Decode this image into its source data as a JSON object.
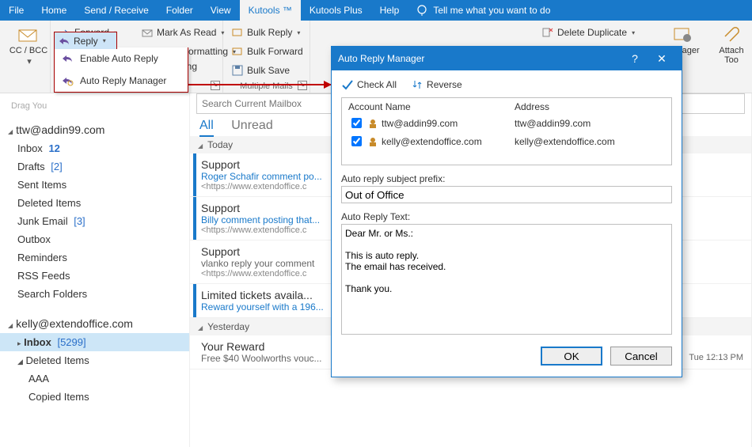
{
  "tabs": {
    "file": "File",
    "home": "Home",
    "sendrecv": "Send / Receive",
    "folder": "Folder",
    "view": "View",
    "kutools": "Kutools ™",
    "kutoolsplus": "Kutools Plus",
    "help": "Help",
    "tellme": "Tell me what you want to do"
  },
  "ribbon": {
    "ccbcc": "CC / BCC",
    "forward": "Forward",
    "markread": "Mark As Read",
    "reply": "Reply",
    "fixedfmt": "Fixed Formatting",
    "dragyour": "Drag You",
    "bulkreply": "Bulk Reply",
    "bulkfwd": "Bulk Forward",
    "bulksave": "Bulk Save",
    "multiple": "Multiple Mails",
    "deldup": "Delete Duplicate",
    "manager": "Manager",
    "attachtools": "Attach\nToo",
    "ing": "ing"
  },
  "reply_menu": {
    "enable": "Enable Auto Reply",
    "manager": "Auto Reply Manager"
  },
  "nav": {
    "drag": "Drag You",
    "acct1": "ttw@addin99.com",
    "inbox_label": "Inbox",
    "inbox_count1": "12",
    "drafts": "Drafts",
    "drafts_count": "[2]",
    "sent": "Sent Items",
    "deleted": "Deleted Items",
    "junk": "Junk Email",
    "junk_count": "[3]",
    "outbox": "Outbox",
    "reminders": "Reminders",
    "rss": "RSS Feeds",
    "search": "Search Folders",
    "acct2": "kelly@extendoffice.com",
    "inbox_count2": "[5299]",
    "aaa": "AAA",
    "copied": "Copied Items"
  },
  "list": {
    "search_ph": "Search Current Mailbox",
    "all": "All",
    "unread": "Unread",
    "today": "Today",
    "yesterday": "Yesterday",
    "m1": {
      "subj": "Support",
      "l2": "Roger Schafir comment po...",
      "l3": "<https://www.extendoffice.c"
    },
    "m2": {
      "subj": "Support",
      "l2": "Billy comment posting that...",
      "l3": "<https://www.extendoffice.c"
    },
    "m3": {
      "subj": "Support",
      "l2": "vlanko reply your comment",
      "l3": "<https://www.extendoffice.c"
    },
    "m4": {
      "subj": "Limited tickets availa...",
      "l2": "Reward yourself with a 196...",
      "l3": ""
    },
    "m5": {
      "subj": "Your Reward",
      "l2": "Free $40 Woolworths vouc...",
      "time": "Tue 12:13 PM"
    }
  },
  "dialog": {
    "title": "Auto Reply Manager",
    "help": "?",
    "close": "✕",
    "checkall": "Check All",
    "reverse": "Reverse",
    "col_acc": "Account Name",
    "col_addr": "Address",
    "r1_name": "ttw@addin99.com",
    "r1_addr": "ttw@addin99.com",
    "r2_name": "kelly@extendoffice.com",
    "r2_addr": "kelly@extendoffice.com",
    "prefix_lbl": "Auto reply subject prefix:",
    "prefix_val": "Out of Office",
    "text_lbl": "Auto Reply Text:",
    "text_val": "Dear Mr. or Ms.:\n\nThis is auto reply.\nThe email has received.\n\nThank you.",
    "ok": "OK",
    "cancel": "Cancel"
  }
}
